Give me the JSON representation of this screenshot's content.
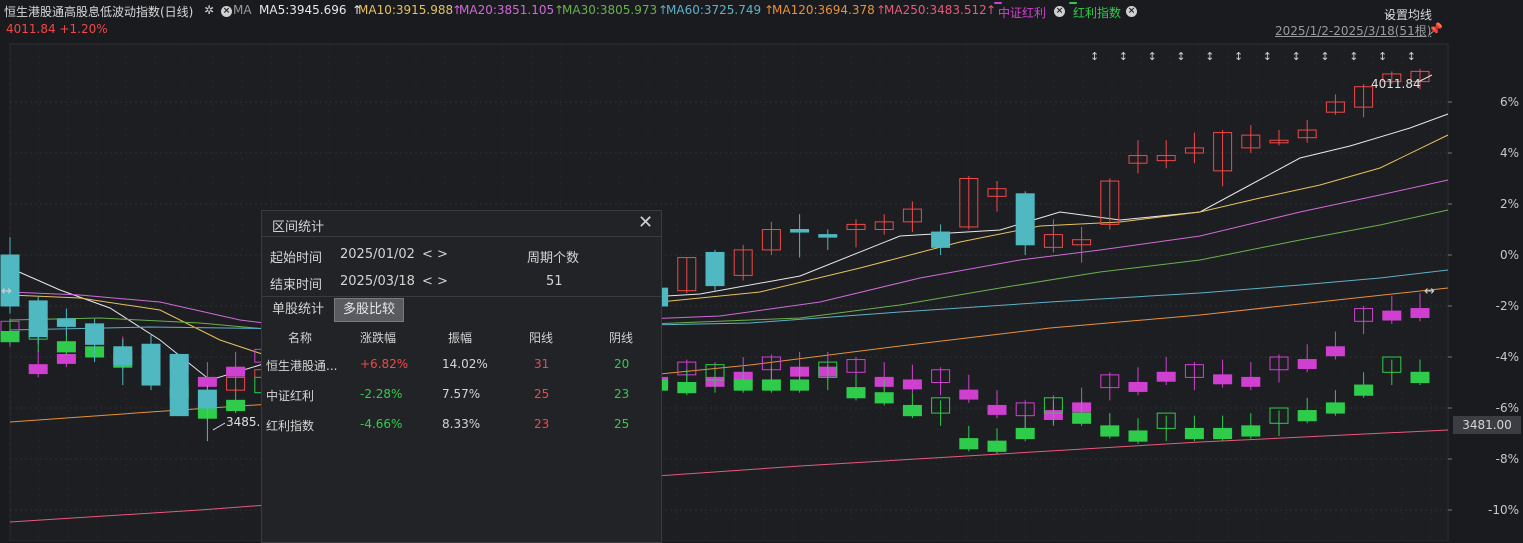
{
  "header": {
    "title": "恒生港股通高股息低波动指数(日线)",
    "ma_label": "MA",
    "ma_items": [
      {
        "label": "MA5:3945.696",
        "color": "#e8e8e8"
      },
      {
        "label": "MA10:3915.988",
        "color": "#e6c25a"
      },
      {
        "label": "MA20:3851.105",
        "color": "#d06ad8"
      },
      {
        "label": "MA30:3805.973",
        "color": "#6ab04c"
      },
      {
        "label": "MA60:3725.749",
        "color": "#5fb0c8"
      },
      {
        "label": "MA120:3694.378",
        "color": "#e8903a"
      },
      {
        "label": "MA250:3483.512",
        "color": "#e85a7a"
      }
    ],
    "compare_tags": [
      {
        "label": "中证红利",
        "color": "#d040d0"
      },
      {
        "label": "红利指数",
        "color": "#2ecc4a"
      }
    ],
    "settings_label": "设置均线",
    "price_change": "4011.84 +1.20%",
    "range_label": "2025/1/2-2025/3/18(51根)"
  },
  "axis": {
    "pct_ticks": [
      "6%",
      "4%",
      "2%",
      "0%",
      "-2%",
      "-4%",
      "-6%",
      "-8%",
      "-10%"
    ],
    "current_price_box": "3481.00",
    "high_label": "4011.84",
    "low_label": "3485.1"
  },
  "panel": {
    "title": "区间统计",
    "start_label": "起始时间",
    "start_value": "2025/01/02",
    "end_label": "结束时间",
    "end_value": "2025/03/18",
    "arrows": "< >",
    "period_label": "周期个数",
    "period_value": "51",
    "tab_single": "单股统计",
    "tab_multi": "多股比较",
    "columns": [
      "名称",
      "涨跌幅",
      "振幅",
      "阳线",
      "阴线"
    ],
    "rows": [
      {
        "name": "恒生港股通...",
        "change": "+6.82%",
        "amp": "14.02%",
        "up": "31",
        "down": "20",
        "dir": "up"
      },
      {
        "name": "中证红利",
        "change": "-2.28%",
        "amp": "7.57%",
        "up": "25",
        "down": "23",
        "dir": "down"
      },
      {
        "name": "红利指数",
        "change": "-4.66%",
        "amp": "8.33%",
        "up": "23",
        "down": "25",
        "dir": "down"
      }
    ]
  },
  "colors": {
    "up": "#f04848",
    "down": "#2ecc4a",
    "main_down": "#4fb8c0",
    "cmp1": "#d040d0",
    "cmp2": "#2ecc4a"
  }
}
